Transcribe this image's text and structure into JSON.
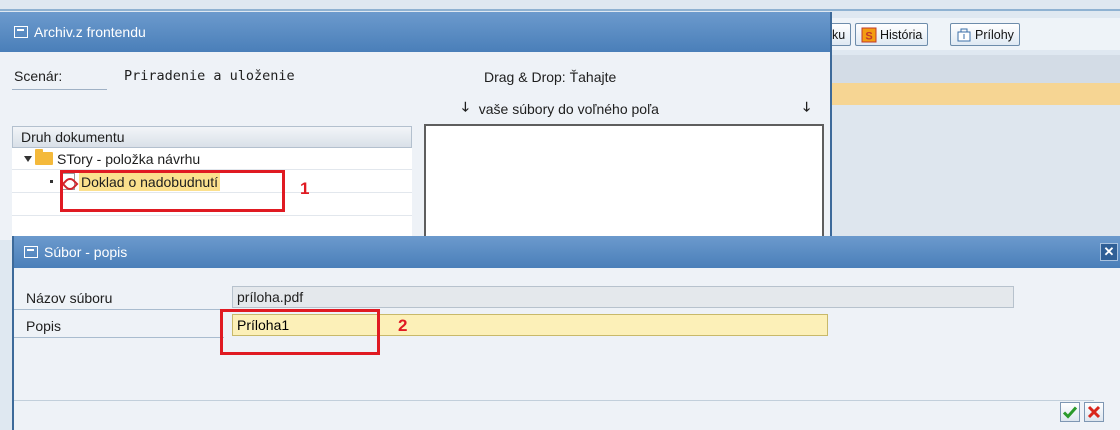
{
  "background_window": {
    "toolbar": {
      "partial_label": "ku",
      "historia_label": "História",
      "prilohy_label": "Prílohy"
    }
  },
  "archiv_dialog": {
    "title": "Archiv.z frontendu",
    "scenar_label": "Scenár:",
    "scenar_value": "Priradenie a uloženie",
    "drag_drop_line1": "Drag & Drop: Ťahajte",
    "drag_drop_line2": "vaše súbory do voľného poľa",
    "tree_header": "Druh dokumentu",
    "tree": {
      "folder_label": "STory - položka návrhu",
      "document_label": "Doklad o nadobudnutí"
    }
  },
  "annotations": {
    "marker_1": "1",
    "marker_2": "2"
  },
  "subor_dialog": {
    "title": "Súbor - popis",
    "nazov_label": "Názov súboru",
    "nazov_value": "príloha.pdf",
    "popis_label": "Popis",
    "popis_value": "Príloha1"
  },
  "colors": {
    "title_bar": "#5a8cc4",
    "highlight": "#fbe08d",
    "annotation_red": "#e01a22",
    "input_yellow": "#fcf0b8"
  }
}
